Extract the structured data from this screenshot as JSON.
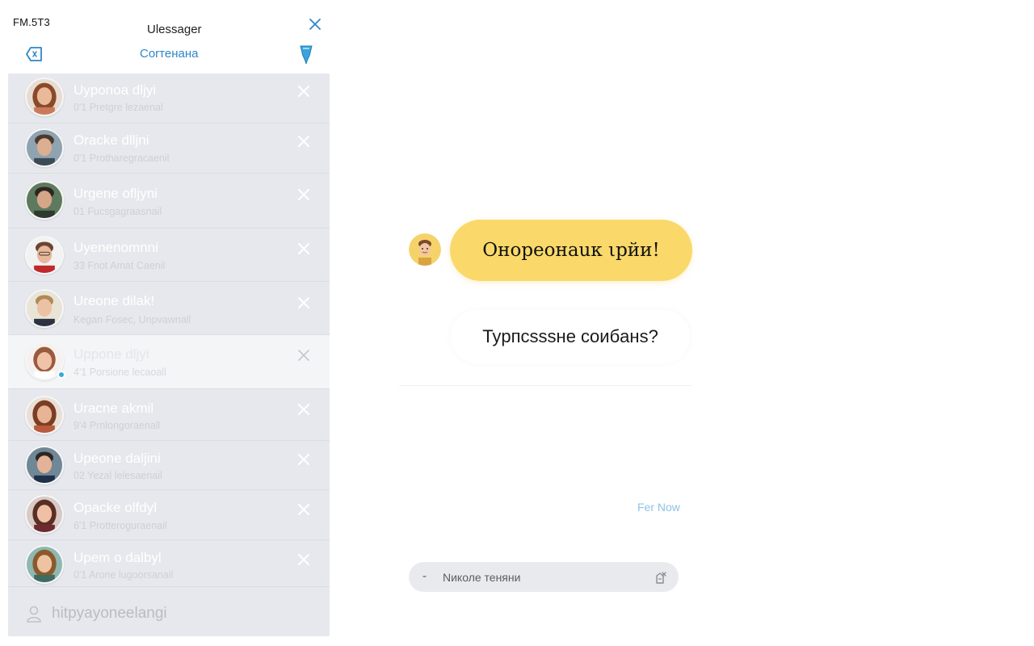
{
  "status_bar": {
    "time": "FM.5T3"
  },
  "header": {
    "title": "Ulessager",
    "subtitle": "Corтенана",
    "icons": {
      "back": "tag-back-icon",
      "pin": "pin-icon",
      "close": "close-icon"
    }
  },
  "conversations": [
    {
      "name": "Uyponoa dljyi",
      "preview": "0'1 Pretgre lezaenal",
      "avatar": "female-avatar"
    },
    {
      "name": "Oracke dlljni",
      "preview": "0'1 Protharegracaenil",
      "avatar": "male-avatar"
    },
    {
      "name": "Urgene ofljyni",
      "preview": "01 Fucsgagraasnail",
      "avatar": "male-avatar"
    },
    {
      "name": "Uyenenomnni",
      "preview": "33 Fnot Amat Caenil",
      "avatar": "male-avatar"
    },
    {
      "name": "Ureone dilak!",
      "preview": "Kegan Fosec, Unpvawnall",
      "avatar": "male-avatar"
    },
    {
      "name": "Uppone dljyi",
      "preview": "4'1 Porsione lecaoall",
      "avatar": "female-avatar",
      "active": true,
      "online": true
    },
    {
      "name": "Uracne akmil",
      "preview": "9'4 Prnlongoraenall",
      "avatar": "female-avatar"
    },
    {
      "name": "Upeone daljini",
      "preview": "02 Yezal lelesaenail",
      "avatar": "male-avatar"
    },
    {
      "name": "Opacke olfdyl",
      "preview": "6'1 Protteroguraenail",
      "avatar": "female-avatar"
    },
    {
      "name": "Upem o dalbyl",
      "preview": "0'1 Arone lugoorsanail",
      "avatar": "female-avatar"
    }
  ],
  "sidebar_footer": {
    "label": "hitpyayoneelangi",
    "icon": "user-icon"
  },
  "chat": {
    "incoming_message": "Oнopeонаuк ιpйи!",
    "outgoing_message": "Typпcsssне coибaнs?",
    "send_later": "Fer Now",
    "composer_prefix": "-",
    "composer_placeholder": "Nиколе теняни",
    "icons": {
      "attach": "attach-icon",
      "avatar": "smiley-avatar"
    }
  },
  "colors": {
    "accent": "#2f86c9",
    "incoming_bubble": "#fad96a",
    "list_background": "#e6e8ed",
    "send_later": "#8fc3e4"
  }
}
